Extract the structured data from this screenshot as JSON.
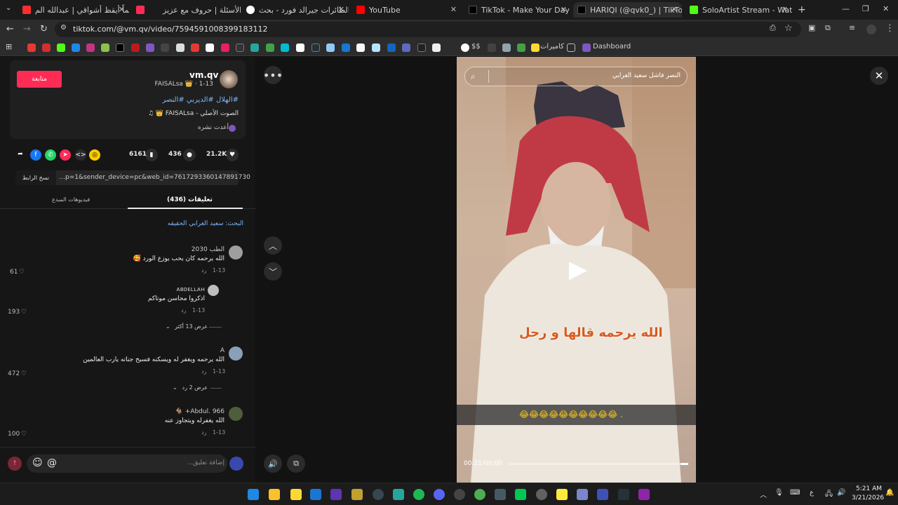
{
  "browser": {
    "tabs": [
      {
        "label": "يا حلماً أيقظ أشواقي | عبدالله الم…",
        "color": "#ff2d2d"
      },
      {
        "label": "",
        "color": "#fe2c55"
      },
      {
        "label": "بوابة الأسئلة | حروف مع عزيز",
        "color": "#ffffff"
      },
      {
        "label": "حاملة الطائرات جيرالد فورد - بحث…",
        "color": "#4285f4"
      },
      {
        "label": "YouTube",
        "color": "#ff0000"
      },
      {
        "label": "TikTok - Make Your Day",
        "color": "#000000"
      },
      {
        "label": "HARIQI (@qvk0_) | TikTok",
        "color": "#000000"
      },
      {
        "label": "SoloArtist Stream - Watch Live",
        "color": "#53fc18"
      }
    ],
    "url": "tiktok.com/@vm.qv/video/7594591008399183112",
    "bookmarks": {
      "cameras": "كاميرات",
      "dashboard": "Dashboard",
      "ss": "$$"
    }
  },
  "post": {
    "username": "vm.qv",
    "display": "FAISALsa 👑 · 1-13",
    "follow": "متابعة",
    "hashtags": "#الهلال #الديربي #النصر",
    "sound": "الصوت الأصلي - FAISALsa 👑 ♫",
    "repost": "أعدت نشره",
    "likes": "21.2K",
    "comments": "436",
    "saves": "6161",
    "link": "…p=1&sender_device=pc&web_id=7617293360147891730",
    "copy_label": "نسخ الرابط"
  },
  "tabs": {
    "comments": "(436) تعليقات",
    "creator_videos": "فيديوهات المبدع"
  },
  "search_hint": "البحث: سعيد الغرابي الحقيقه",
  "comments_list": [
    {
      "user": "الطب 2030",
      "text": "الله يرحمه كان يحب يوزع الورد 🥰",
      "date": "1-13",
      "reply": "رد",
      "likes": "61"
    },
    {
      "user": "ᴀʙᴅᴇʟʟᴀʜ",
      "text": "اذكروا محاسن موتاكم",
      "date": "1-13",
      "reply": "رد",
      "likes": "193",
      "more": "عرض 13 أكثر"
    },
    {
      "user": "A",
      "text": "الله يرحمه ويغفر له ويسكنه فسيح جناته يارب العالمين",
      "date": "1-13",
      "reply": "رد",
      "likes": "472",
      "more": "عرض 2 رد"
    },
    {
      "user": "Abdul. 966+ 🐐",
      "text": "الله يغفرله ويتجاوز عنه",
      "date": "1-13",
      "reply": "رد",
      "likes": "100"
    }
  ],
  "comment_input": {
    "placeholder": "إضافة تعليق..."
  },
  "video": {
    "search": "النصر فاشل سعيد الغرابي",
    "caption": "الله يرحمه قالها و رحل",
    "emojis": "😂😂😂😂😂😂😂😂😂😂 .",
    "time": "00:21/00:00"
  },
  "taskbar": {
    "time": "5:21 AM",
    "date": "3/21/2026",
    "lang": "ع"
  }
}
